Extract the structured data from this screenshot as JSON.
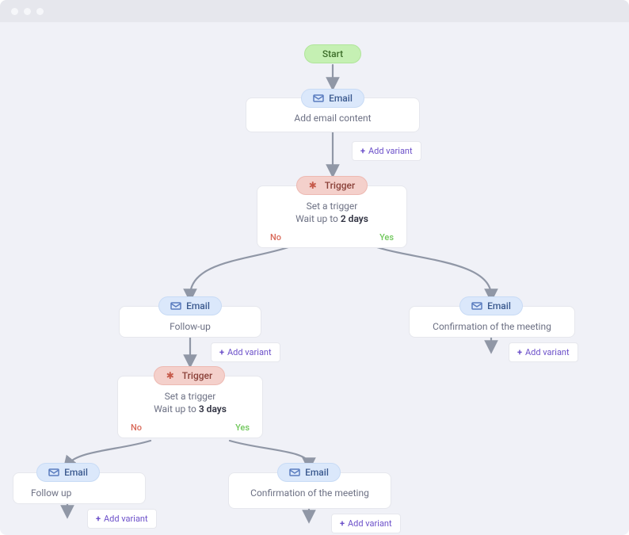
{
  "start": {
    "label": "Start"
  },
  "nodes": {
    "email1": {
      "pill": "Email",
      "body": "Add email content"
    },
    "trigger1": {
      "pill": "Trigger",
      "body": "Set a trigger",
      "wait_prefix": "Wait up to",
      "wait_days": "2 days",
      "no": "No",
      "yes": "Yes"
    },
    "email_followup": {
      "pill": "Email",
      "body": "Follow-up"
    },
    "email_confirm1": {
      "pill": "Email",
      "body": "Confirmation of the meeting"
    },
    "trigger2": {
      "pill": "Trigger",
      "body": "Set a trigger",
      "wait_prefix": "Wait up to",
      "wait_days": "3 days",
      "no": "No",
      "yes": "Yes"
    },
    "email_followup2": {
      "pill": "Email",
      "body": "Follow up"
    },
    "email_confirm2": {
      "pill": "Email",
      "body": "Confirmation of the meeting"
    }
  },
  "buttons": {
    "add_variant": "Add variant"
  }
}
